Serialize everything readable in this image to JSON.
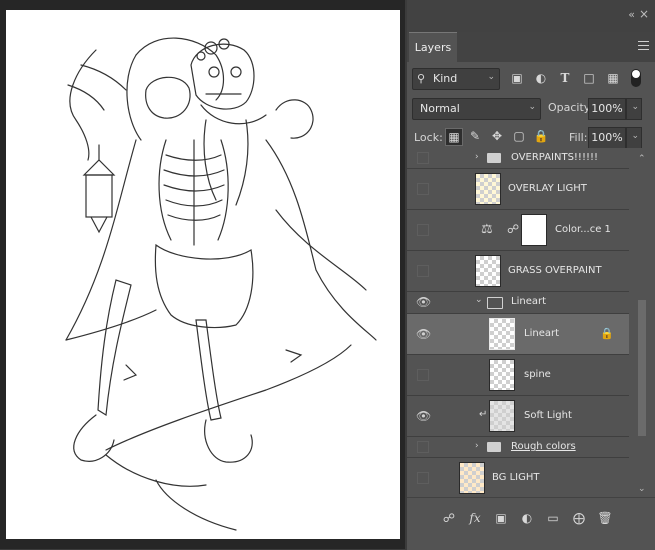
{
  "panel": {
    "tab": "Layers",
    "filter_kind": "Kind",
    "blend_mode": "Normal",
    "opacity_label": "Opacity:",
    "opacity_value": "100%",
    "lock_label": "Lock:",
    "fill_label": "Fill:",
    "fill_value": "100%"
  },
  "layers": [
    {
      "name": "OVERPAINTS!!!!!!",
      "type": "group",
      "visible": false
    },
    {
      "name": "OVERLAY LIGHT",
      "type": "layer",
      "visible": false
    },
    {
      "name": "Color...ce 1",
      "type": "adjustment",
      "visible": false
    },
    {
      "name": "GRASS OVERPAINT",
      "type": "layer",
      "visible": false
    },
    {
      "name": "Lineart",
      "type": "group-open",
      "visible": true
    },
    {
      "name": "Lineart",
      "type": "layer",
      "visible": true,
      "selected": true,
      "locked": true
    },
    {
      "name": "spine",
      "type": "layer",
      "visible": false
    },
    {
      "name": "Soft Light",
      "type": "clipped-layer",
      "visible": true
    },
    {
      "name": "Rough colors",
      "type": "group",
      "visible": false
    },
    {
      "name": "BG LIGHT",
      "type": "layer",
      "visible": false
    }
  ],
  "colors": {
    "panel_bg": "#535353",
    "selected_row": "#6a6a6a",
    "canvas_bg": "#262626"
  }
}
